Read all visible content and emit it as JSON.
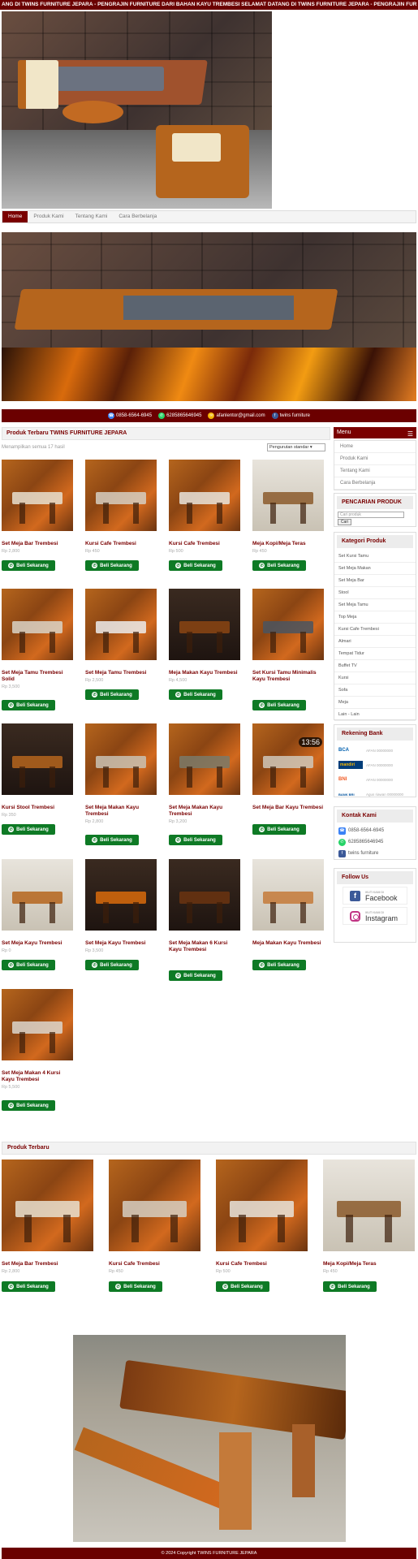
{
  "marquee": "ANG DI TWINS FURNITURE JEPARA - PENGRAJIN FURNITURE DARI BAHAN KAYU TREMBESI      SELAMAT DATANG DI TWINS FURNITURE JEPARA - PENGRAJIN FUR",
  "nav": {
    "items": [
      "Home",
      "Produk Kami",
      "Tentang Kami",
      "Cara Berbelanja"
    ]
  },
  "contact_bar": {
    "phone": "0858-6564-6945",
    "whatsapp": "6285865646945",
    "email": "afanlentor@gmail.com",
    "facebook": "twins furniture"
  },
  "main": {
    "heading": "Produk Terbaru TWINS FURNITURE JEPARA",
    "result_count": "Menampilkan semua 17 hasil",
    "sort_value": "Pengurutan standar",
    "buy_label": "Beli Sekarang",
    "video_time": "13:56"
  },
  "products": [
    {
      "name": "Set Meja Bar Trembesi",
      "price": "Rp 2,800"
    },
    {
      "name": "Kursi Cafe Trembesi",
      "price": "Rp 450"
    },
    {
      "name": "Kursi Cafe Trembesi",
      "price": "Rp 500"
    },
    {
      "name": "Meja Kopi/Meja Teras",
      "price": "Rp 450"
    },
    {
      "name": "Set Meja Tamu Trembesi Solid",
      "price": "Rp 3,500"
    },
    {
      "name": "Set Meja Tamu Trembesi",
      "price": "Rp 2,500"
    },
    {
      "name": "Meja Makan Kayu Trembesi",
      "price": "Rp 4,500"
    },
    {
      "name": "Set Kursi Tamu Minimalis Kayu Trembesi",
      "price": ""
    },
    {
      "name": "Kursi Stool Trembesi",
      "price": "Rp 350"
    },
    {
      "name": "Set Meja Makan Kayu Trembesi",
      "price": "Rp 2,800"
    },
    {
      "name": "Set Meja Makan Kayu Trembesi",
      "price": "Rp 3,200"
    },
    {
      "name": "Set Meja Bar Kayu Trembesi",
      "price": ""
    },
    {
      "name": "Set Meja Kayu Trembesi",
      "price": "Rp 0"
    },
    {
      "name": "Set Meja Kayu Trembesi",
      "price": "Rp 3,500"
    },
    {
      "name": "Set Meja Makan 6 Kursi Kayu Trembesi",
      "price": ""
    },
    {
      "name": "Meja Makan Kayu Trembesi",
      "price": ""
    },
    {
      "name": "Set Meja Makan 4 Kursi Kayu Trembesi",
      "price": "Rp 5,500"
    }
  ],
  "sidebar": {
    "menu_title": "Menu",
    "menu_items": [
      "Home",
      "Produk Kami",
      "Tentang Kami",
      "Cara Berbelanja"
    ],
    "search_title": "PENCARIAN PRODUK",
    "search_placeholder": "Cari produk",
    "search_button": "Cari",
    "category_title": "Kategori Produk",
    "categories": [
      "Set Kursi Tamu",
      "Set Meja Makan",
      "Set Meja Bar",
      "Stool",
      "Set Meja Tamu",
      "Top Meja",
      "Kursi Cafe Trembesi",
      "Almari",
      "Tempat Tidur",
      "Buffet TV",
      "Kursi",
      "Sofa",
      "Meja",
      "Lain - Lain"
    ],
    "bank_title": "Rekening Bank",
    "banks": [
      {
        "name": "BCA",
        "account": "AFAN 00000000",
        "color": "#0060af"
      },
      {
        "name": "mandiri",
        "account": "AFAN 00000000",
        "color": "#003d79"
      },
      {
        "name": "BNI",
        "account": "AFAN 00000000",
        "color": "#f15a23"
      },
      {
        "name": "BANK BRI",
        "account": "Agus riawan 00000000",
        "color": "#00529c"
      }
    ],
    "contact_title": "Kontak Kami",
    "contacts": [
      "0858-6564-6945",
      "6285865646945",
      "twins furniture"
    ],
    "follow_title": "Follow Us",
    "follow": [
      {
        "small": "IKUTI KAMI DI",
        "big": "Facebook"
      },
      {
        "small": "IKUTI KAMI DI",
        "big": "Instagram"
      }
    ]
  },
  "latest": {
    "heading": "Produk Terbaru",
    "items": [
      {
        "name": "Set Meja Bar Trembesi",
        "price": "Rp 2,800"
      },
      {
        "name": "Kursi Cafe Trembesi",
        "price": "Rp 450"
      },
      {
        "name": "Kursi Cafe Trembesi",
        "price": "Rp 500"
      },
      {
        "name": "Meja Kopi/Meja Teras",
        "price": "Rp 450"
      }
    ]
  },
  "footer": "© 2024 Copyright TWINS FURNITURE JEPARA"
}
